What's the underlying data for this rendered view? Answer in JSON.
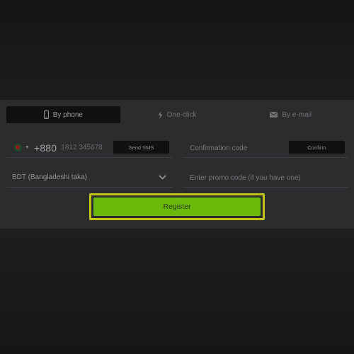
{
  "tabs": [
    {
      "label": "By phone",
      "icon": "phone-icon",
      "active": true
    },
    {
      "label": "One-click",
      "icon": "lightning-icon",
      "active": false
    },
    {
      "label": "By e-mail",
      "icon": "envelope-icon",
      "active": false
    }
  ],
  "phone": {
    "country_flag": "bangladesh-flag-icon",
    "dial_code": "+880",
    "placeholder": "1812 345678",
    "send_sms_label": "Send SMS"
  },
  "confirmation": {
    "placeholder": "Confirmation code",
    "button_label": "Confirm"
  },
  "currency": {
    "selected": "BDT (Bangladeshi taka)",
    "icon": "chevron-down-icon"
  },
  "promo": {
    "placeholder": "Enter promo code (if you have one)"
  },
  "register": {
    "label": "Register"
  },
  "colors": {
    "accent": "#6ab90b",
    "highlight": "#c3c412",
    "panel": "#2a2c2e"
  }
}
